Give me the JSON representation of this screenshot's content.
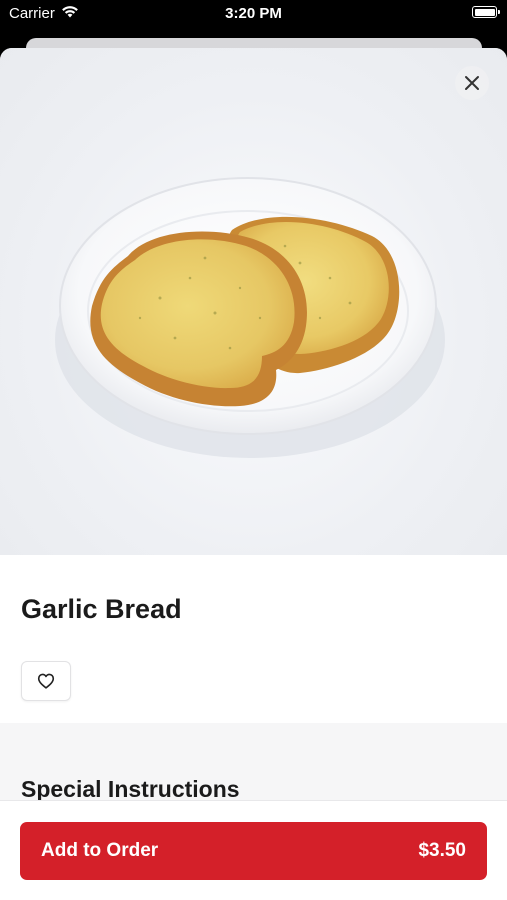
{
  "status_bar": {
    "carrier": "Carrier",
    "time": "3:20 PM"
  },
  "item": {
    "name": "Garlic Bread",
    "image_alt": "Garlic bread slices on a white plate"
  },
  "sections": {
    "special_instructions_title": "Special Instructions"
  },
  "footer": {
    "add_label": "Add to Order",
    "price": "$3.50"
  },
  "colors": {
    "accent": "#d42029",
    "background_gray": "#f6f6f7"
  },
  "icons": {
    "close": "close-icon",
    "favorite": "heart-outline-icon",
    "wifi": "wifi-icon",
    "battery": "battery-icon"
  }
}
